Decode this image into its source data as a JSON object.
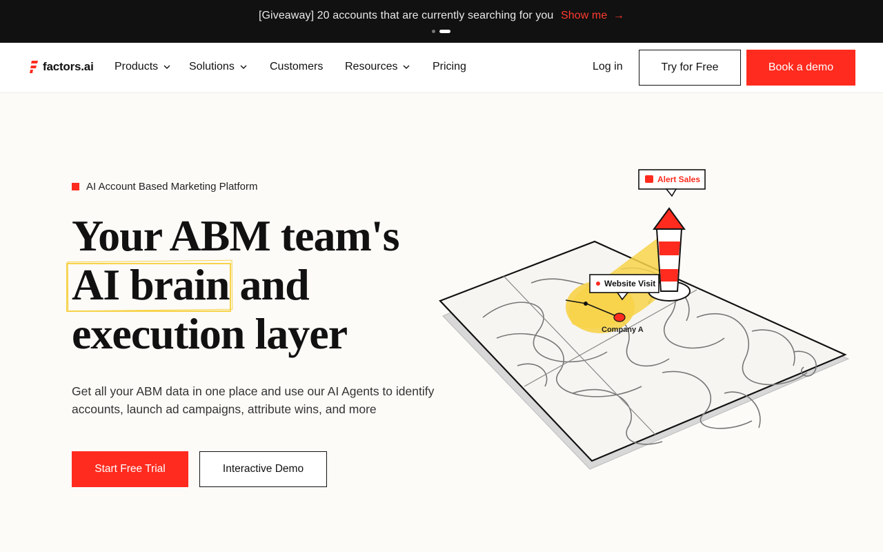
{
  "announcement": {
    "text": "[Giveaway] 20 accounts that are currently searching for you",
    "link_label": "Show me",
    "arrow": "→"
  },
  "nav": {
    "logo_text": "factors.ai",
    "items": [
      {
        "label": "Products",
        "has_dropdown": true
      },
      {
        "label": "Solutions",
        "has_dropdown": true
      },
      {
        "label": "Customers",
        "has_dropdown": false
      },
      {
        "label": "Resources",
        "has_dropdown": true
      },
      {
        "label": "Pricing",
        "has_dropdown": false
      }
    ],
    "login_label": "Log in",
    "try_label": "Try for Free",
    "demo_label": "Book a demo"
  },
  "hero": {
    "eyebrow": "AI Account Based Marketing Platform",
    "headline_line1": "Your ABM team's",
    "headline_highlight": "AI brain",
    "headline_line2_rest": " and",
    "headline_line3": "execution layer",
    "subtext": "Get all your ABM data in one place and use our AI Agents to identify accounts, launch ad campaigns, attribute wins, and more",
    "cta_primary": "Start Free Trial",
    "cta_secondary": "Interactive Demo"
  },
  "illustration": {
    "alert_label": "Alert Sales",
    "visit_label": "Website Visit",
    "company_label": "Company A"
  },
  "colors": {
    "brand_red": "#ff2b1f",
    "highlight_yellow": "#f7d34a",
    "announce_bg": "#111111"
  }
}
